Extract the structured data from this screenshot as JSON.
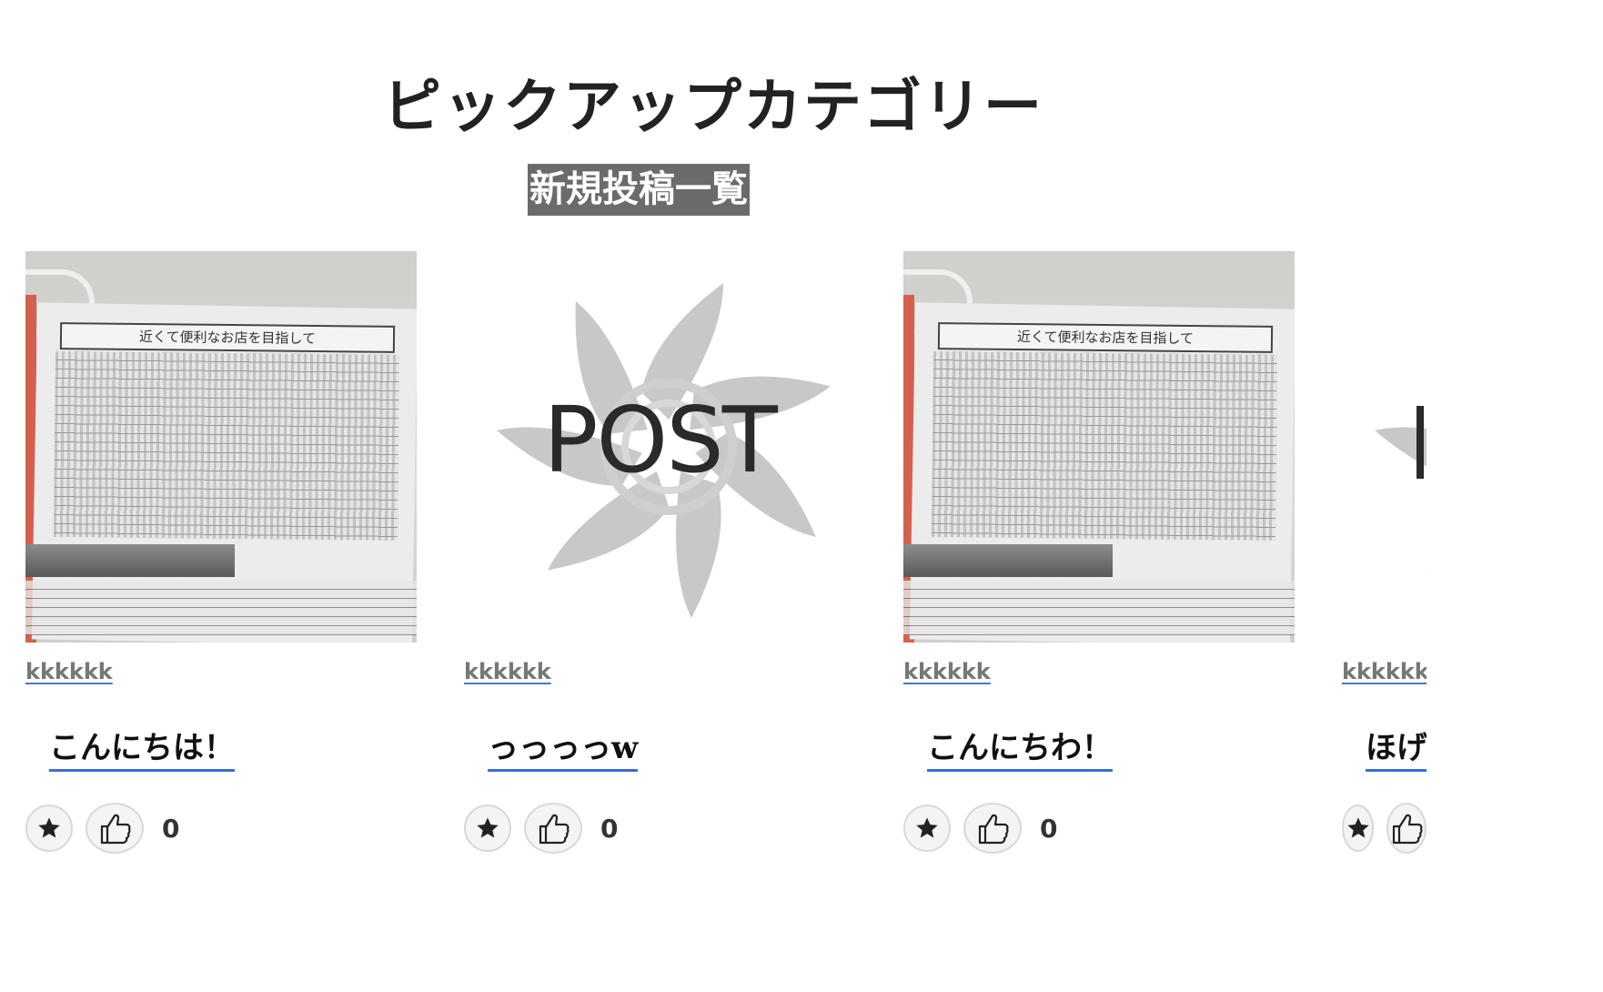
{
  "page": {
    "title": "ピックアップカテゴリー",
    "section_label": "新規投稿一覧"
  },
  "posts": [
    {
      "author": "kkkkkk",
      "title": "こんにちは！",
      "like_count": "0",
      "thumbnail": {
        "type": "photo",
        "banner_text": "近くて便利なお店を目指して"
      }
    },
    {
      "author": "kkkkkk",
      "title": "っっっっw",
      "like_count": "0",
      "thumbnail": {
        "type": "placeholder",
        "word": "POST"
      }
    },
    {
      "author": "kkkkkk",
      "title": "こんにちわ！",
      "like_count": "0",
      "thumbnail": {
        "type": "photo",
        "banner_text": "近くて便利なお店を目指して"
      }
    },
    {
      "author": "kkkkkk",
      "title": "ほげ",
      "like_count": "",
      "thumbnail": {
        "type": "placeholder",
        "word": ""
      }
    }
  ],
  "icons": {
    "favorite": "star-icon",
    "like": "thumbs-up-icon"
  },
  "colors": {
    "section_label_bg": "#6b6b6b",
    "title_underline": "#3a6fd0",
    "swirl": "#c8c8c8"
  }
}
